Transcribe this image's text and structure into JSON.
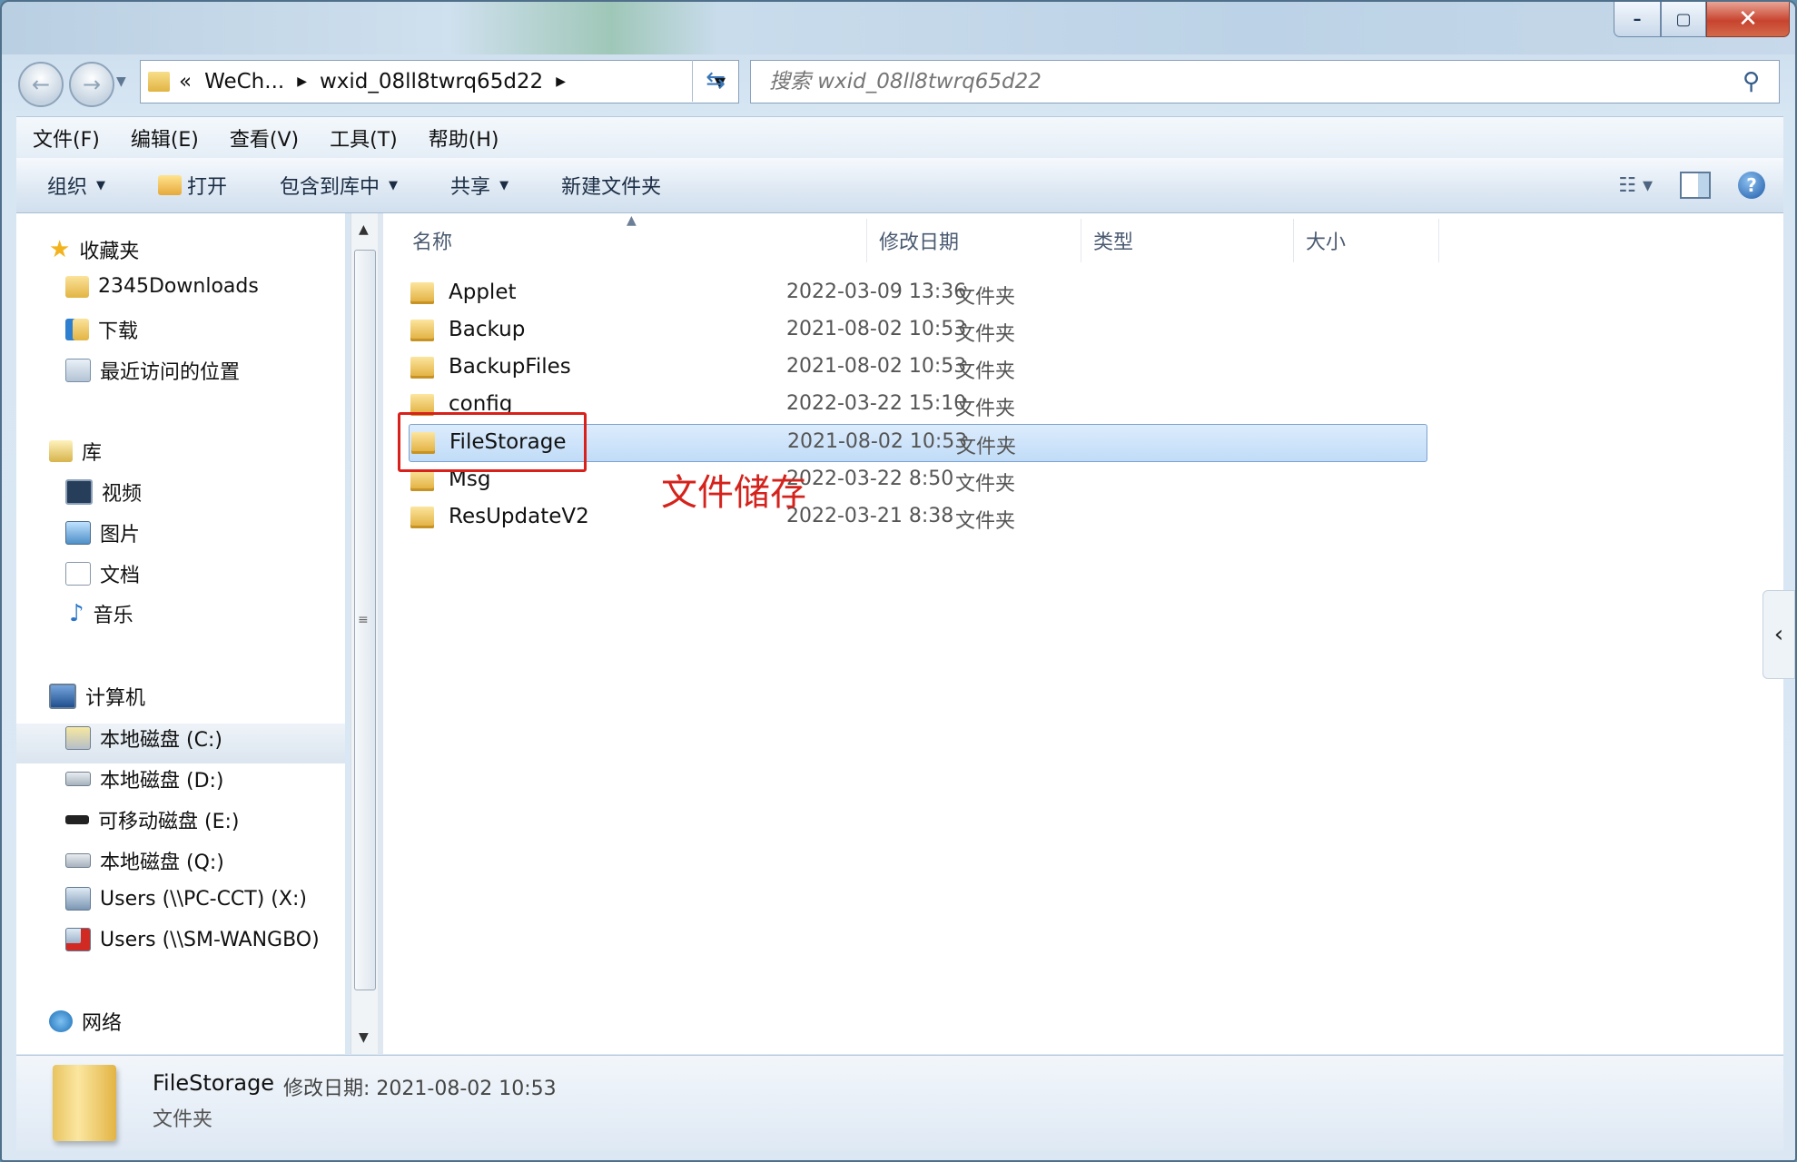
{
  "address": {
    "crumbs": [
      "WeCh...",
      "wxid_08ll8twrq65d22"
    ],
    "overflow": "«"
  },
  "search": {
    "placeholder": "搜索 wxid_08ll8twrq65d22"
  },
  "menubar": [
    "文件(F)",
    "编辑(E)",
    "查看(V)",
    "工具(T)",
    "帮助(H)"
  ],
  "toolbar": {
    "organize": "组织",
    "open": "打开",
    "include_library": "包含到库中",
    "share": "共享",
    "new_folder": "新建文件夹"
  },
  "nav": {
    "favorites": "收藏夹",
    "fav_items": [
      "2345Downloads",
      "下载",
      "最近访问的位置"
    ],
    "libraries": "库",
    "lib_items": [
      "视频",
      "图片",
      "文档",
      "音乐"
    ],
    "computer": "计算机",
    "drives": [
      "本地磁盘 (C:)",
      "本地磁盘 (D:)",
      "可移动磁盘 (E:)",
      "本地磁盘 (Q:)",
      "Users (\\\\PC-CCT) (X:)",
      "Users (\\\\SM-WANGBO)"
    ],
    "network": "网络"
  },
  "columns": {
    "name": "名称",
    "date": "修改日期",
    "type": "类型",
    "size": "大小"
  },
  "files": [
    {
      "name": "Applet",
      "date": "2022-03-09 13:36",
      "type": "文件夹"
    },
    {
      "name": "Backup",
      "date": "2021-08-02 10:53",
      "type": "文件夹"
    },
    {
      "name": "BackupFiles",
      "date": "2021-08-02 10:53",
      "type": "文件夹"
    },
    {
      "name": "config",
      "date": "2022-03-22 15:10",
      "type": "文件夹"
    },
    {
      "name": "FileStorage",
      "date": "2021-08-02 10:53",
      "type": "文件夹",
      "selected": true
    },
    {
      "name": "Msg",
      "date": "2022-03-22 8:50",
      "type": "文件夹"
    },
    {
      "name": "ResUpdateV2",
      "date": "2022-03-21 8:38",
      "type": "文件夹"
    }
  ],
  "annotation": "文件储存",
  "details": {
    "name": "FileStorage",
    "meta": "修改日期: 2021-08-02 10:53",
    "type": "文件夹"
  },
  "colors": {
    "selection": "#c1dcf8",
    "annotation": "#d4231c"
  }
}
